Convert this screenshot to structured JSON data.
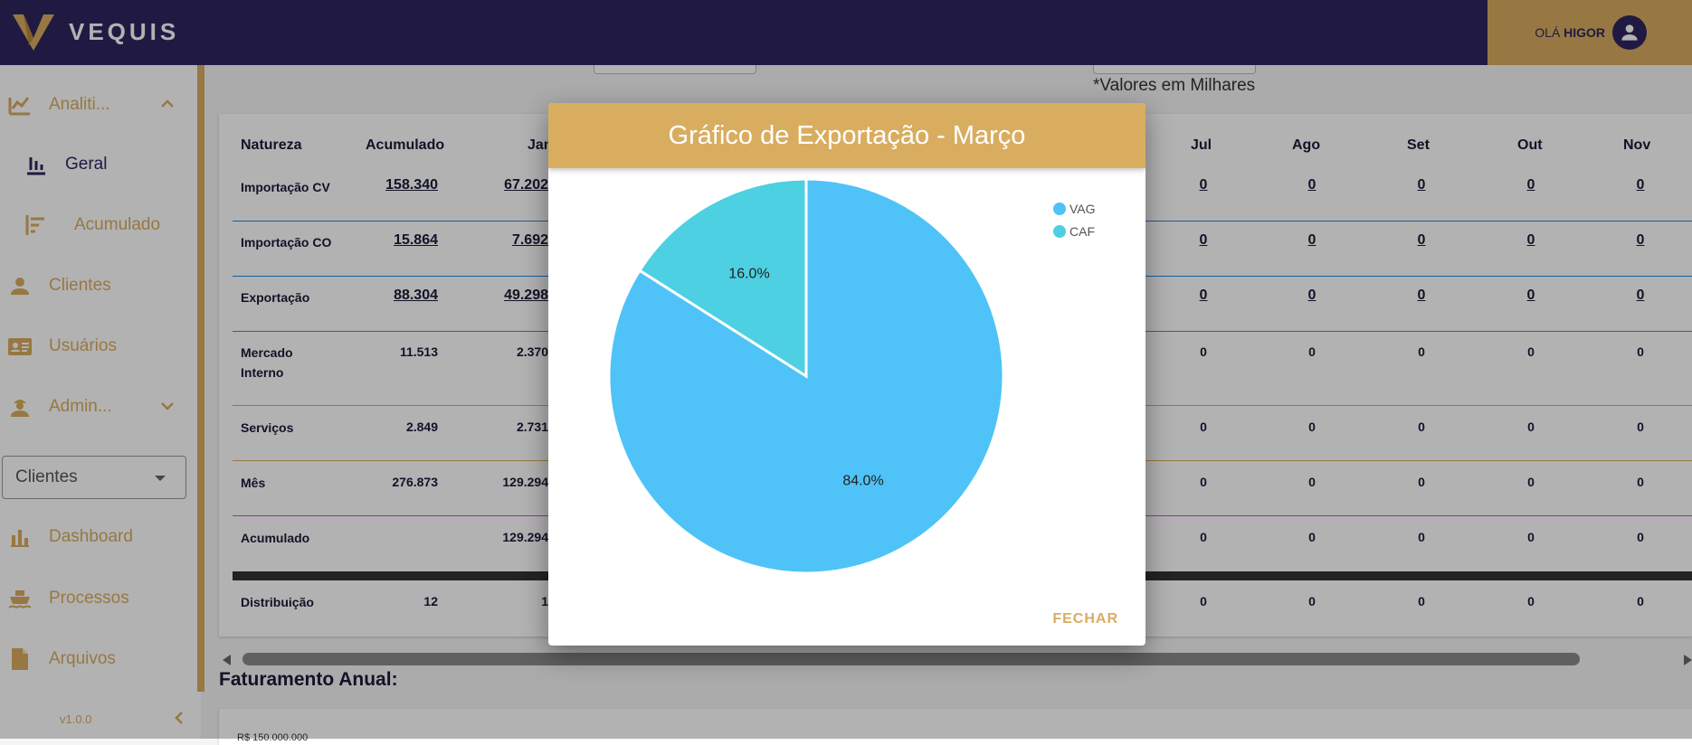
{
  "header": {
    "brand": "VEQUIS",
    "greeting": "OLÁ",
    "user_name": "HIGOR"
  },
  "sidebar": {
    "items": [
      {
        "label": "Analiti...",
        "icon": "analytics-icon"
      },
      {
        "label": "Geral",
        "icon": "bar-chart-icon"
      },
      {
        "label": "Acumulado",
        "icon": "horizontal-bars-icon"
      },
      {
        "label": "Clientes",
        "icon": "person-icon"
      },
      {
        "label": "Usuários",
        "icon": "id-card-icon"
      },
      {
        "label": "Admin...",
        "icon": "engineer-icon"
      }
    ],
    "select_value": "Clientes",
    "items2": [
      {
        "label": "Dashboard",
        "icon": "bar-chart-icon"
      },
      {
        "label": "Processos",
        "icon": "ship-icon"
      },
      {
        "label": "Arquivos",
        "icon": "file-icon"
      }
    ],
    "version": "v1.0.0"
  },
  "main": {
    "note": "*Valores em Milhares",
    "columns": [
      "Natureza",
      "Acumulado",
      "Jan",
      "Jul",
      "Ago",
      "Set",
      "Out",
      "Nov"
    ],
    "rows": [
      {
        "label": "Importação CV",
        "acumulado": "158.340",
        "jan": "67.202",
        "rest": [
          "0",
          "0",
          "0",
          "0",
          "0"
        ],
        "link": true
      },
      {
        "label": "Importação CO",
        "acumulado": "15.864",
        "jan": "7.692",
        "rest": [
          "0",
          "0",
          "0",
          "0",
          "0"
        ],
        "link": true
      },
      {
        "label": "Exportação",
        "acumulado": "88.304",
        "jan": "49.298",
        "rest": [
          "0",
          "0",
          "0",
          "0",
          "0"
        ],
        "link": true
      },
      {
        "label_l1": "Mercado",
        "label_l2": "Interno",
        "acumulado": "11.513",
        "jan": "2.370",
        "rest": [
          "0",
          "0",
          "0",
          "0",
          "0"
        ],
        "link": false
      },
      {
        "label": "Serviços",
        "acumulado": "2.849",
        "jan": "2.731",
        "rest": [
          "0",
          "0",
          "0",
          "0",
          "0"
        ],
        "link": false
      },
      {
        "label": "Mês",
        "acumulado": "276.873",
        "jan": "129.294",
        "rest": [
          "0",
          "0",
          "0",
          "0",
          "0"
        ],
        "link": false
      },
      {
        "label": "Acumulado",
        "acumulado": "",
        "jan": "129.294",
        "rest": [
          "0",
          "0",
          "0",
          "0",
          "0"
        ],
        "link": false
      },
      {
        "label": "Distribuição",
        "acumulado": "12",
        "jan": "1",
        "rest": [
          "0",
          "0",
          "0",
          "0",
          "0"
        ],
        "link": false
      }
    ],
    "faturamento_title": "Faturamento Anual:",
    "faturamento_first_tick": "R$ 150.000.000"
  },
  "modal": {
    "title": "Gráfico de Exportação - Março",
    "close_label": "FECHAR",
    "colors": {
      "VAG": "#4fc3f7",
      "CAF": "#4dd0e1",
      "header": "#d9ad5f"
    }
  },
  "chart_data": {
    "type": "pie",
    "title": "Gráfico de Exportação - Março",
    "slices": [
      {
        "label": "VAG",
        "value": 84.0,
        "display": "84.0%"
      },
      {
        "label": "CAF",
        "value": 16.0,
        "display": "16.0%"
      }
    ],
    "legend": "top-right"
  }
}
